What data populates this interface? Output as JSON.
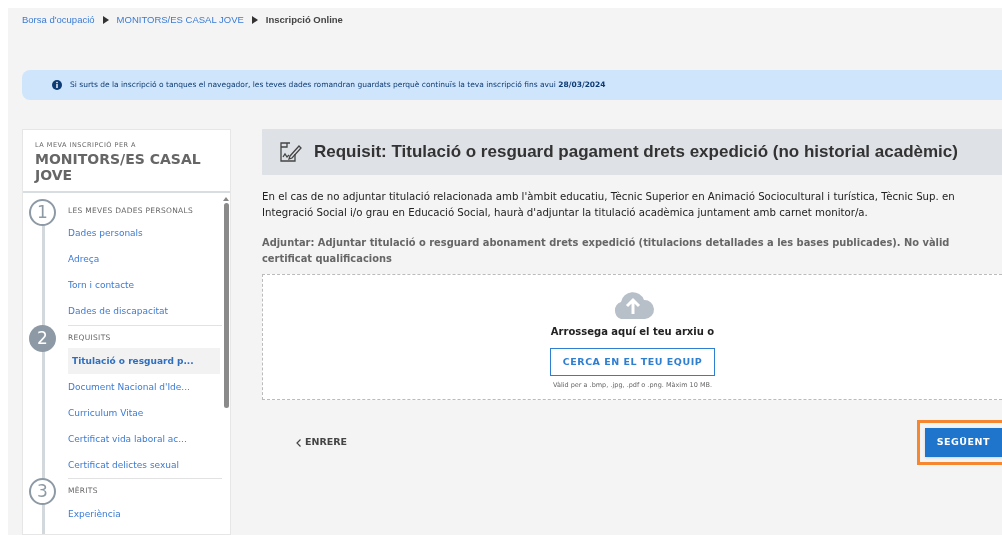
{
  "breadcrumb": [
    {
      "label": "Borsa d'ocupació",
      "current": false
    },
    {
      "label": "MONITORS/ES CASAL JOVE",
      "current": false
    },
    {
      "label": "Inscripció Online",
      "current": true
    }
  ],
  "notice": {
    "text": "Si surts de la inscripció o tanques el navegador, les teves dades romandran guardats perquè continuïs la teva inscripció fins avui **28/03/2024**"
  },
  "sidebar": {
    "subtitle": "LA MEVA INSCRIPCIÓ PER A",
    "title": "MONITORS/ES CASAL JOVE",
    "steps": [
      {
        "number": "1",
        "label": "LES MEVES DADES PERSONALS",
        "current": false,
        "items": [
          {
            "label": "Dades personals",
            "selected": false
          },
          {
            "label": "Adreça",
            "selected": false
          },
          {
            "label": "Torn i contacte",
            "selected": false
          },
          {
            "label": "Dades de discapacitat",
            "selected": false
          }
        ]
      },
      {
        "number": "2",
        "label": "REQUISITS",
        "current": true,
        "items": [
          {
            "label": "Titulació o resguard p...",
            "selected": true
          },
          {
            "label": "Document Nacional d'Ide...",
            "selected": false
          },
          {
            "label": "Curriculum Vitae",
            "selected": false
          },
          {
            "label": "Certificat vida laboral ac...",
            "selected": false
          },
          {
            "label": "Certificat delictes sexual",
            "selected": false
          }
        ]
      },
      {
        "number": "3",
        "label": "MÈRITS",
        "current": false,
        "items": [
          {
            "label": "Experiència",
            "selected": false
          }
        ]
      }
    ]
  },
  "main": {
    "title": "Requisit: Titulació o resguard pagament drets expedició (no historial acadèmic)",
    "description": "En el cas de no adjuntar titulació relacionada amb l'àmbit educatiu, Tècnic Superior en Animació Sociocultural i turística, Tècnic Sup. en Integració Social i/o grau en Educació Social, haurà d'adjuntar la titulació acadèmica juntament amb carnet monitor/a.",
    "attach_note": "Adjuntar: Adjuntar titulació o resguard abonament drets expedició (titulacions detallades a les bases publicades). No vàlid certificat qualificacions",
    "dropzone": {
      "prompt": "Arrossega aquí el teu arxiu o",
      "button": "CERCA EN EL TEU EQUIP",
      "hint": "Vàlid per a .bmp, .jpg, .pdf o .png. Màxim 10 MB."
    },
    "back_button": "ENRERE",
    "next_button": {
      "label": "SEGÜENT",
      "highlighted": true
    }
  }
}
